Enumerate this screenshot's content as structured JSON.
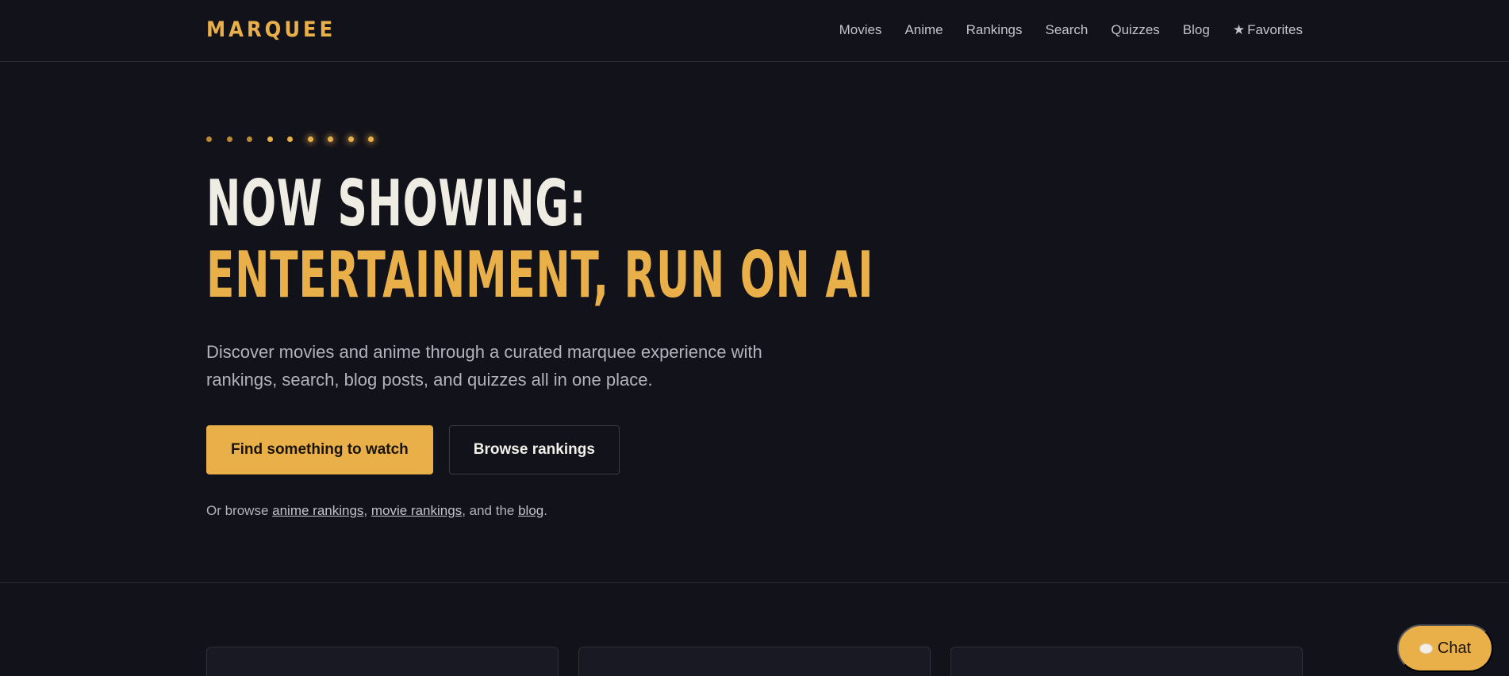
{
  "header": {
    "logo": "MARQUEE",
    "nav": [
      {
        "label": "Movies"
      },
      {
        "label": "Anime"
      },
      {
        "label": "Rankings"
      },
      {
        "label": "Search"
      },
      {
        "label": "Quizzes"
      },
      {
        "label": "Blog"
      },
      {
        "label": "Favorites",
        "icon": "star-icon",
        "glyph": "★"
      }
    ]
  },
  "hero": {
    "line1": "NOW SHOWING:",
    "line2": "ENTERTAINMENT, RUN ON AI",
    "lead": "Discover movies and anime through a curated marquee experience with rankings, search, blog posts, and quizzes all in one place.",
    "primary_cta": "Find something to watch",
    "secondary_cta": "Browse rankings",
    "browse": {
      "prefix": "Or browse ",
      "link1": "anime rankings",
      "sep1": ", ",
      "link2": "movie rankings",
      "sep2": ", and the ",
      "link3": "blog",
      "suffix": "."
    }
  },
  "chat": {
    "label": "Chat",
    "icon": "speech-bubble-icon"
  },
  "colors": {
    "background": "#12121a",
    "accent": "#e9b04a",
    "text": "#efece4",
    "muted": "#b3b2bd"
  }
}
